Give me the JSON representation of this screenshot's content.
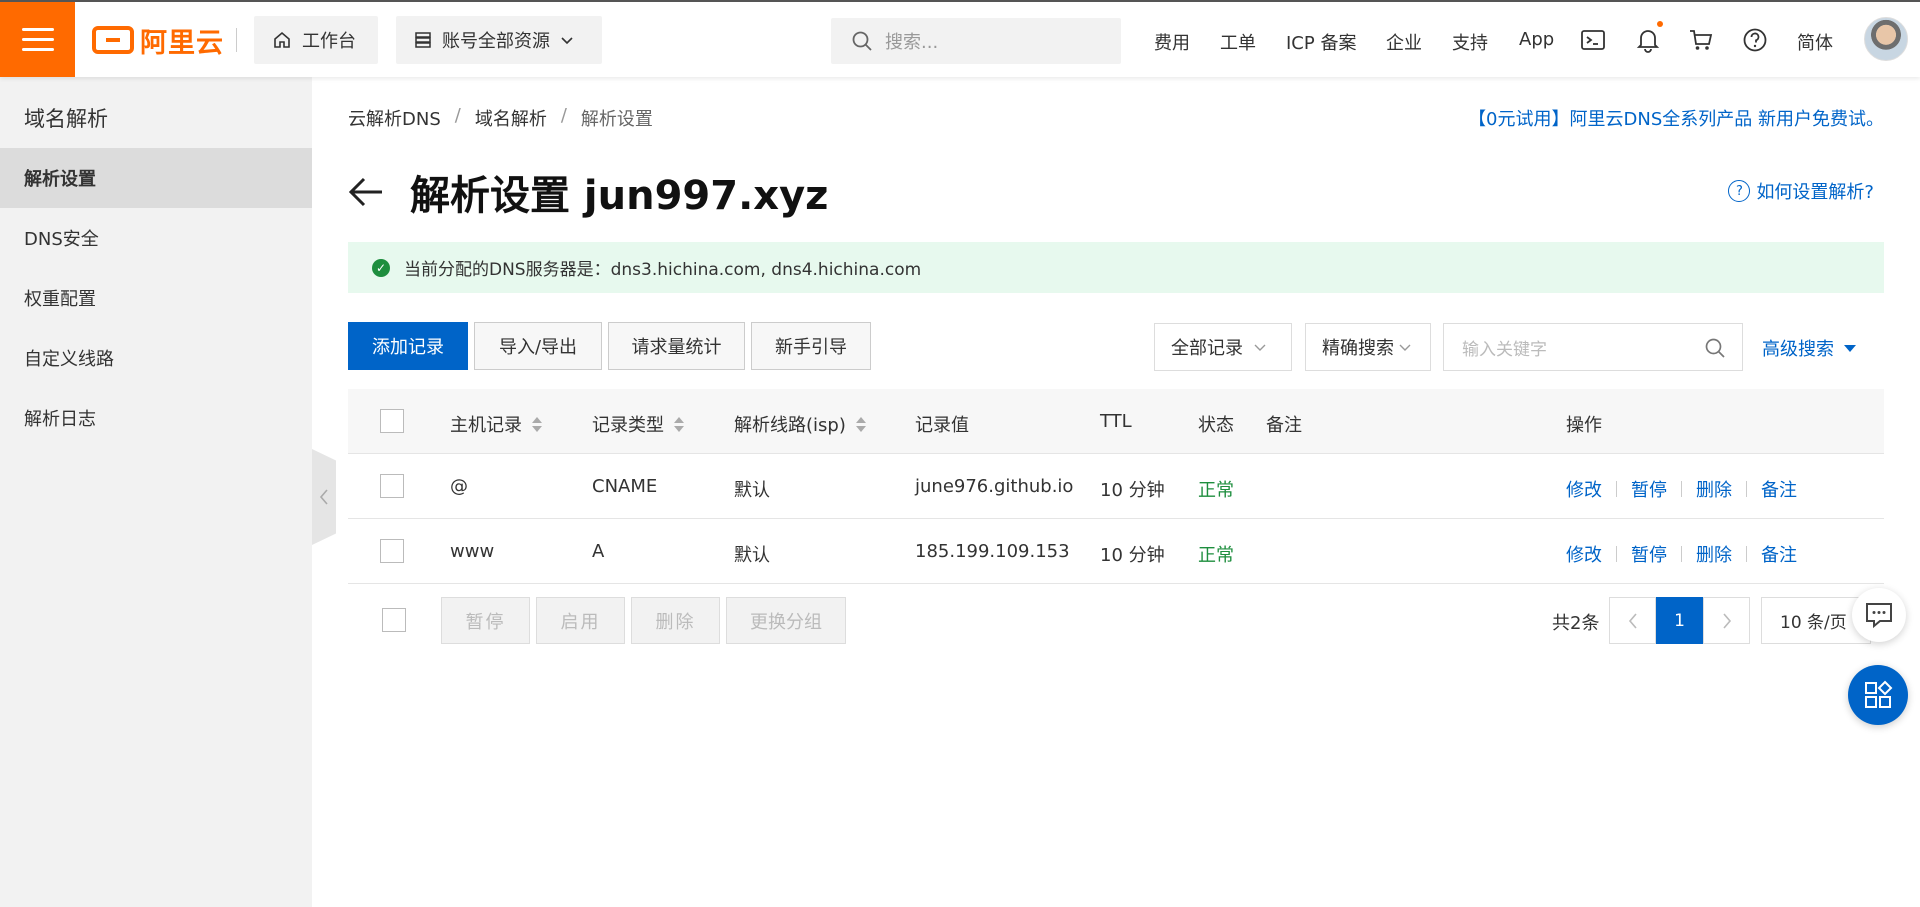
{
  "topbar": {
    "logo_text": "阿里云",
    "workbench_label": "工作台",
    "resources_label": "账号全部资源",
    "search_placeholder": "搜索...",
    "nav": [
      "费用",
      "工单",
      "ICP 备案",
      "企业",
      "支持",
      "App"
    ],
    "language_label": "简体",
    "icons": [
      "terminal-icon",
      "bell-icon",
      "cart-icon",
      "help-icon"
    ],
    "brand_color": "#ff6a00"
  },
  "sidebar": {
    "title": "域名解析",
    "items": [
      {
        "label": "解析设置",
        "active": true
      },
      {
        "label": "DNS安全",
        "active": false
      },
      {
        "label": "权重配置",
        "active": false
      },
      {
        "label": "自定义线路",
        "active": false
      },
      {
        "label": "解析日志",
        "active": false
      }
    ]
  },
  "breadcrumb": [
    "云解析DNS",
    "域名解析",
    "解析设置"
  ],
  "breadcrumb_sep": "/",
  "promo": "【0元试用】阿里云DNS全系列产品 新用户免费试。",
  "page_title": "解析设置 jun997.xyz",
  "help_link": "如何设置解析?",
  "notice": "当前分配的DNS服务器是：dns3.hichina.com, dns4.hichina.com",
  "toolbar": {
    "add_record": "添加记录",
    "import_export": "导入/导出",
    "request_stats": "请求量统计",
    "guide": "新手引导",
    "filter_all": "全部记录",
    "search_mode": "精确搜索",
    "keyword_placeholder": "输入关键字",
    "advanced_search": "高级搜索"
  },
  "table": {
    "headers": [
      "主机记录",
      "记录类型",
      "解析线路(isp)",
      "记录值",
      "TTL",
      "状态",
      "备注",
      "操作"
    ],
    "rows": [
      {
        "host": "@",
        "type": "CNAME",
        "line": "默认",
        "value": "june976.github.io",
        "ttl": "10 分钟",
        "status": "正常",
        "remark": ""
      },
      {
        "host": "www",
        "type": "A",
        "line": "默认",
        "value": "185.199.109.153",
        "ttl": "10 分钟",
        "status": "正常",
        "remark": ""
      }
    ],
    "row_actions": [
      "修改",
      "暂停",
      "删除",
      "备注"
    ]
  },
  "footer": {
    "pause": "暂停",
    "enable": "启用",
    "delete": "删除",
    "change_group": "更换分组",
    "total": "共2条",
    "current_page": "1",
    "page_size": "10 条/页"
  },
  "accent_color": "#0064c8",
  "status_color": "#1e8e3e"
}
